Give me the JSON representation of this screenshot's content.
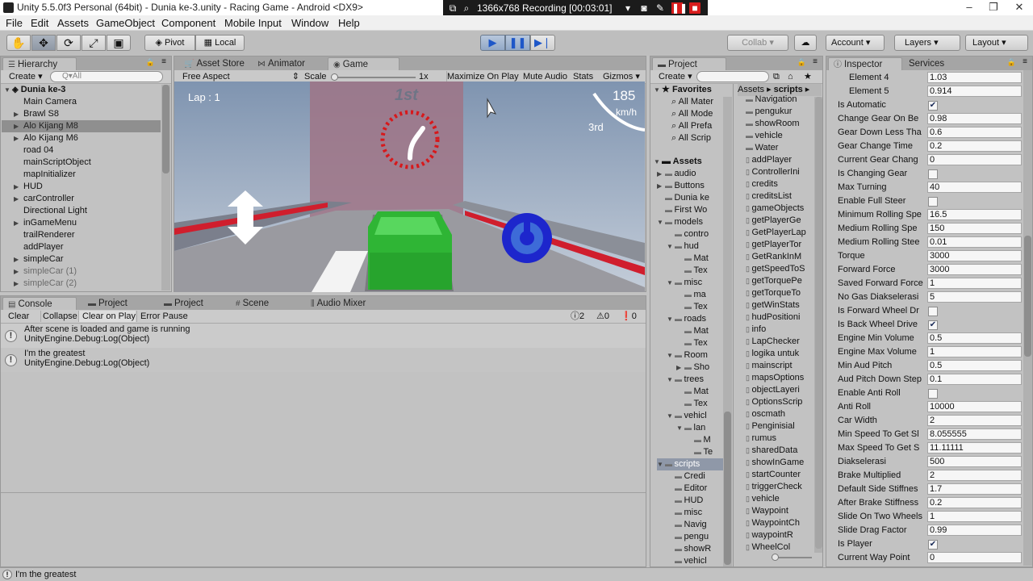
{
  "window": {
    "title": "Unity 5.5.0f3 Personal (64bit) - Dunia ke-3.unity - Racing Game - Android <DX9>",
    "controls": [
      "‒",
      "❐",
      "✕"
    ]
  },
  "recorder": {
    "label": "1366x768  Recording [00:03:01]"
  },
  "menu": [
    "File",
    "Edit",
    "Assets",
    "GameObject",
    "Component",
    "Mobile Input",
    "Window",
    "Help"
  ],
  "toolbar": {
    "pivot": "Pivot",
    "local": "Local",
    "collab": "Collab ▾",
    "account": "Account",
    "layers": "Layers",
    "layout": "Layout"
  },
  "hierarchy": {
    "tab": "Hierarchy",
    "create": "Create",
    "search_placeholder": "Q▾All",
    "scene": "Dunia ke-3",
    "items": [
      {
        "label": "Main Camera",
        "arrow": ""
      },
      {
        "label": "Brawl S8",
        "arrow": "▶"
      },
      {
        "label": "Alo Kijang M8",
        "arrow": "▶",
        "selected": true
      },
      {
        "label": "Alo Kijang M6",
        "arrow": "▶"
      },
      {
        "label": "road 04",
        "arrow": ""
      },
      {
        "label": "mainScriptObject",
        "arrow": ""
      },
      {
        "label": "mapInitializer",
        "arrow": ""
      },
      {
        "label": "HUD",
        "arrow": "▶"
      },
      {
        "label": "carController",
        "arrow": "▶"
      },
      {
        "label": "Directional Light",
        "arrow": ""
      },
      {
        "label": "inGameMenu",
        "arrow": "▶"
      },
      {
        "label": "trailRenderer",
        "arrow": ""
      },
      {
        "label": "addPlayer",
        "arrow": ""
      },
      {
        "label": "simpleCar",
        "arrow": "▶"
      },
      {
        "label": "simpleCar (1)",
        "arrow": "▶",
        "disabled": true
      },
      {
        "label": "simpleCar (2)",
        "arrow": "▶",
        "disabled": true
      }
    ]
  },
  "center_tabs": [
    "Asset Store",
    "Animator",
    "Game"
  ],
  "game": {
    "aspect": "Free Aspect",
    "scale_label": "Scale",
    "scale_value": "1x",
    "maximize": "Maximize On Play",
    "mute": "Mute Audio",
    "stats": "Stats",
    "gizmos": "Gizmos",
    "lap": "Lap : 1",
    "position": "1st",
    "speed": "185",
    "speed_unit": "km/h",
    "rank": "3rd"
  },
  "console_tabs": [
    "Console",
    "Project",
    "Project",
    "Scene",
    "Audio Mixer"
  ],
  "console": {
    "buttons": [
      "Clear",
      "Collapse",
      "Clear on Play",
      "Error Pause"
    ],
    "counts": {
      "info": "2",
      "warn": "0",
      "error": "0"
    },
    "logs": [
      {
        "line1": "After scene is loaded and game is running",
        "line2": "UnityEngine.Debug:Log(Object)"
      },
      {
        "line1": "I'm the greatest",
        "line2": "UnityEngine.Debug:Log(Object)"
      }
    ]
  },
  "project": {
    "tab": "Project",
    "create": "Create",
    "breadcrumb_root": "Assets",
    "breadcrumb_leaf": "scripts",
    "favorites_title": "Favorites",
    "favorites": [
      "All Mater",
      "All Mode",
      "All Prefa",
      "All Scrip"
    ],
    "assets_title": "Assets",
    "tree": [
      {
        "label": "audio",
        "indent": 0,
        "arrow": "▶"
      },
      {
        "label": "Buttons",
        "indent": 0,
        "arrow": "▶"
      },
      {
        "label": "Dunia ke",
        "indent": 0,
        "arrow": ""
      },
      {
        "label": "First Wo",
        "indent": 0,
        "arrow": ""
      },
      {
        "label": "models",
        "indent": 0,
        "arrow": "▼"
      },
      {
        "label": "contro",
        "indent": 1,
        "arrow": ""
      },
      {
        "label": "hud",
        "indent": 1,
        "arrow": "▼"
      },
      {
        "label": "Mat",
        "indent": 2,
        "arrow": ""
      },
      {
        "label": "Tex",
        "indent": 2,
        "arrow": ""
      },
      {
        "label": "misc",
        "indent": 1,
        "arrow": "▼"
      },
      {
        "label": "ma",
        "indent": 2,
        "arrow": ""
      },
      {
        "label": "Tex",
        "indent": 2,
        "arrow": ""
      },
      {
        "label": "roads",
        "indent": 1,
        "arrow": "▼"
      },
      {
        "label": "Mat",
        "indent": 2,
        "arrow": ""
      },
      {
        "label": "Tex",
        "indent": 2,
        "arrow": ""
      },
      {
        "label": "Room",
        "indent": 1,
        "arrow": "▼"
      },
      {
        "label": "Sho",
        "indent": 2,
        "arrow": "▶"
      },
      {
        "label": "trees",
        "indent": 1,
        "arrow": "▼"
      },
      {
        "label": "Mat",
        "indent": 2,
        "arrow": ""
      },
      {
        "label": "Tex",
        "indent": 2,
        "arrow": ""
      },
      {
        "label": "vehicl",
        "indent": 1,
        "arrow": "▼"
      },
      {
        "label": "lan",
        "indent": 2,
        "arrow": "▼"
      },
      {
        "label": "M",
        "indent": 3,
        "arrow": ""
      },
      {
        "label": "Te",
        "indent": 3,
        "arrow": ""
      },
      {
        "label": "scripts",
        "indent": 0,
        "arrow": "▼",
        "selected": true
      },
      {
        "label": "Credi",
        "indent": 1,
        "arrow": ""
      },
      {
        "label": "Editor",
        "indent": 1,
        "arrow": ""
      },
      {
        "label": "HUD",
        "indent": 1,
        "arrow": ""
      },
      {
        "label": "misc",
        "indent": 1,
        "arrow": ""
      },
      {
        "label": "Navig",
        "indent": 1,
        "arrow": ""
      },
      {
        "label": "pengu",
        "indent": 1,
        "arrow": ""
      },
      {
        "label": "showR",
        "indent": 1,
        "arrow": ""
      },
      {
        "label": "vehicl",
        "indent": 1,
        "arrow": ""
      }
    ],
    "folders": [
      "Navigation",
      "pengukur",
      "showRoom",
      "vehicle",
      "Water"
    ],
    "files": [
      "addPlayer",
      "ControllerIni",
      "credits",
      "creditsList",
      "gameObjects",
      "getPlayerGe",
      "GetPlayerLap",
      "getPlayerTor",
      "GetRankInM",
      "getSpeedToS",
      "getTorquePe",
      "getTorqueTo",
      "getWinStats",
      "hudPositioni",
      "info",
      "LapChecker",
      "logika untuk",
      "mainscript",
      "mapsOptions",
      "objectLayeri",
      "OptionsScrip",
      "oscmath",
      "Penginisial",
      "rumus",
      "sharedData",
      "showInGame",
      "startCounter",
      "triggerCheck",
      "vehicle",
      "Waypoint",
      "WaypointCh",
      "waypointR",
      "WheelCol"
    ]
  },
  "inspector": {
    "tabs": [
      "Inspector",
      "Services"
    ],
    "props": [
      {
        "label": "Element 4",
        "value": "1.03",
        "indent": true
      },
      {
        "label": "Element 5",
        "value": "0.914",
        "indent": true
      },
      {
        "label": "Is Automatic",
        "check": true
      },
      {
        "label": "Change Gear On Be",
        "value": "0.98"
      },
      {
        "label": "Gear Down Less Tha",
        "value": "0.6"
      },
      {
        "label": "Gear Change Time",
        "value": "0.2"
      },
      {
        "label": "Current Gear Chang",
        "value": "0"
      },
      {
        "label": "Is Changing Gear",
        "check": false
      },
      {
        "label": "Max Turning",
        "value": "40"
      },
      {
        "label": "Enable Full Steer",
        "check": false
      },
      {
        "label": "Minimum Rolling Spe",
        "value": "16.5"
      },
      {
        "label": "Medium Rolling Spe",
        "value": "150"
      },
      {
        "label": "Medium Rolling Stee",
        "value": "0.01"
      },
      {
        "label": "Torque",
        "value": "3000"
      },
      {
        "label": "Forward Force",
        "value": "3000"
      },
      {
        "label": "Saved Forward Force",
        "value": "1"
      },
      {
        "label": "No Gas Diakselerasi",
        "value": "5"
      },
      {
        "label": "Is Forward Wheel Dr",
        "check": false
      },
      {
        "label": "Is Back Wheel Drive",
        "check": true
      },
      {
        "label": "Engine Min Volume",
        "value": "0.5"
      },
      {
        "label": "Engine Max Volume",
        "value": "1"
      },
      {
        "label": "Min Aud Pitch",
        "value": "0.5"
      },
      {
        "label": "Aud Pitch Down Step",
        "value": "0.1"
      },
      {
        "label": "Enable Anti Roll",
        "check": false
      },
      {
        "label": "Anti Roll",
        "value": "10000"
      },
      {
        "label": "Car Width",
        "value": "2"
      },
      {
        "label": "Min Speed To Get Sl",
        "value": "8.055555"
      },
      {
        "label": "Max Speed To Get S",
        "value": "11.11111"
      },
      {
        "label": "Diakselerasi",
        "value": "500"
      },
      {
        "label": "Brake Multiplied",
        "value": "2"
      },
      {
        "label": "Default Side Stiffnes",
        "value": "1.7"
      },
      {
        "label": "After Brake Stiffness",
        "value": "0.2"
      },
      {
        "label": "Slide On Two Wheels",
        "value": "1"
      },
      {
        "label": "Slide Drag Factor",
        "value": "0.99"
      },
      {
        "label": "Is Player",
        "check": true
      },
      {
        "label": "Current Way Point",
        "value": "0"
      }
    ]
  },
  "status": {
    "message": "I'm the greatest"
  }
}
